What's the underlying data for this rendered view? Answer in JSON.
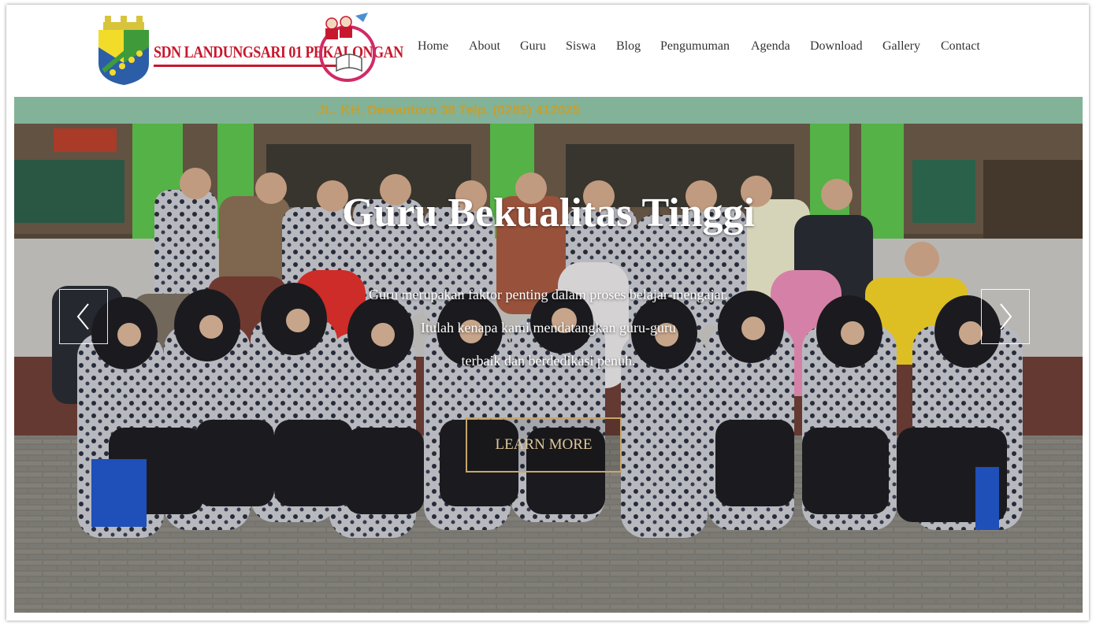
{
  "header": {
    "school_name": "SDN LANDUNGSARI 01 PEKALONGAN",
    "nav": [
      {
        "label": "Home",
        "name": "nav-home"
      },
      {
        "label": "About",
        "name": "nav-about"
      },
      {
        "label": "Guru",
        "name": "nav-guru"
      },
      {
        "label": "Siswa",
        "name": "nav-siswa"
      },
      {
        "label": "Blog",
        "name": "nav-blog"
      },
      {
        "label": "Pengumuman",
        "name": "nav-pengumuman"
      },
      {
        "label": "Agenda",
        "name": "nav-agenda"
      },
      {
        "label": "Download",
        "name": "nav-download"
      },
      {
        "label": "Gallery",
        "name": "nav-gallery"
      },
      {
        "label": "Contact",
        "name": "nav-contact"
      }
    ]
  },
  "hero": {
    "banner_text": "JL. KH. Dewantoro 38 Telp. (0285) 412025",
    "title": "Guru Bekualitas Tinggi",
    "lines": [
      "Guru merupakan faktor penting dalam proses belajar-mengajar.",
      "Itulah kenapa kami mendatangkan guru-guru",
      "terbaik dan berdedikasi penuh."
    ],
    "cta": "LEARN MORE",
    "prev_icon": "chevron-left-icon",
    "next_icon": "chevron-right-icon"
  },
  "colors": {
    "brand_red": "#c8182d",
    "cta_border": "#c8a66a",
    "wall_green": "#5cc24e"
  }
}
